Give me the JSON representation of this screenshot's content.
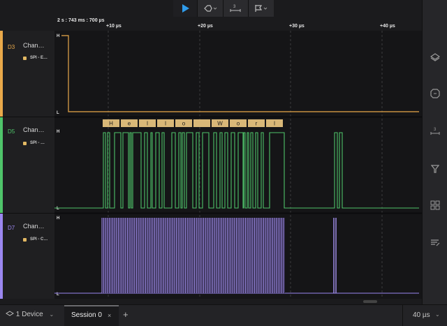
{
  "toolbar": {
    "play_icon": "play-icon",
    "trigger_icon": "trigger-icon",
    "measure_label": "3",
    "flag_icon": "flag-icon"
  },
  "timeline": {
    "absolute_time": "2 s : 743 ms : 700 µs",
    "ticks": [
      "+10 µs",
      "+20 µs",
      "+30 µs",
      "+40 µs"
    ]
  },
  "channels": [
    {
      "id": "D3",
      "name": "Chan…",
      "analyzer": "SPI - E…",
      "color": "#e9a94a",
      "high": "H",
      "low": "L"
    },
    {
      "id": "D5",
      "name": "Chan…",
      "analyzer": "SPI - …",
      "color": "#4fc46a",
      "high": "H",
      "low": "L"
    },
    {
      "id": "D7",
      "name": "Chan…",
      "analyzer": "SPI - C…",
      "color": "#9b87f0",
      "high": "H",
      "low": "L"
    }
  ],
  "decoded_bytes": [
    "H",
    "e",
    "l",
    "l",
    "o",
    " ",
    "W",
    "o",
    "r",
    "l"
  ],
  "right_rail": [
    "layers-icon",
    "analyzer-icon",
    "measure-icon",
    "filter-icon",
    "extensions-icon",
    "notes-icon"
  ],
  "measure_rail_label": "3",
  "bottom": {
    "device_label": "1 Device",
    "session_label": "Session 0",
    "close_glyph": "×",
    "add_glyph": "+",
    "zoom_value": "40 µs"
  }
}
